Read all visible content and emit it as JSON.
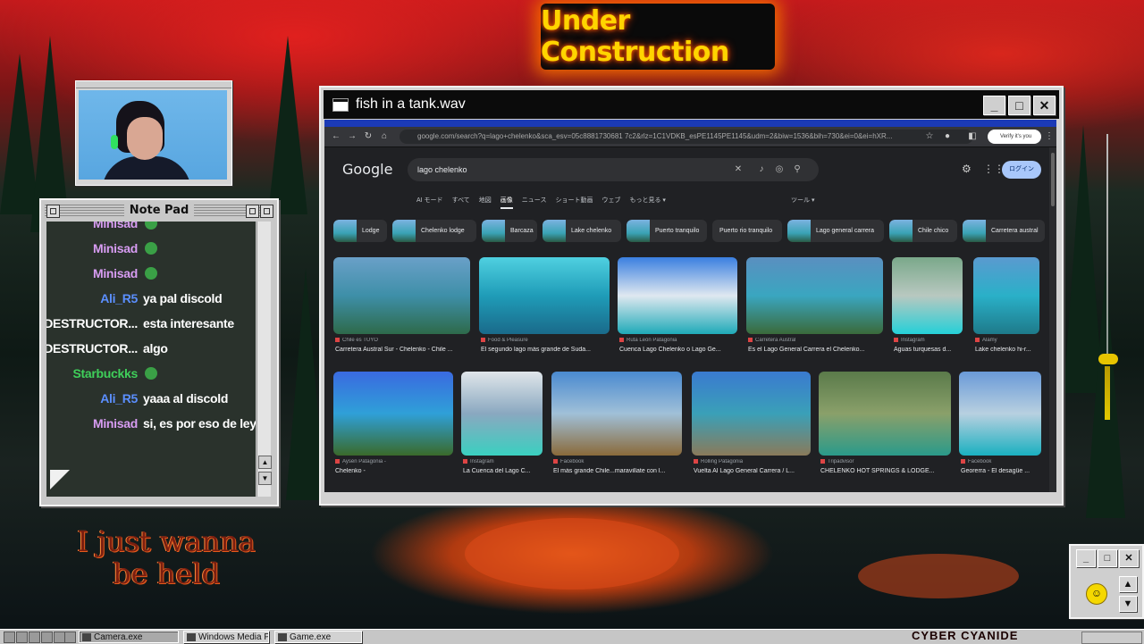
{
  "overlays": {
    "under_construction": "Under Construction",
    "held_line1": "I just wanna",
    "held_line2": "be held",
    "brand": "CYBER CYANIDE"
  },
  "notepad": {
    "title": "Note Pad",
    "messages": [
      {
        "user": "Minisad",
        "text": "",
        "user_color": "#d79cf2",
        "emote": true
      },
      {
        "user": "Minisad",
        "text": "",
        "user_color": "#d79cf2",
        "emote": true
      },
      {
        "user": "Minisad",
        "text": "",
        "user_color": "#d79cf2",
        "emote": true
      },
      {
        "user": "Ali_R5",
        "text": "ya pal discold",
        "user_color": "#5b8fff",
        "emote": false
      },
      {
        "user": "DESTRUCTOR...",
        "text": "esta interesante",
        "user_color": "#ffffff",
        "emote": false
      },
      {
        "user": "DESTRUCTOR...",
        "text": "algo",
        "user_color": "#ffffff",
        "emote": false
      },
      {
        "user": "Starbuckks",
        "text": "",
        "user_color": "#3fcf5a",
        "emote": true
      },
      {
        "user": "Ali_R5",
        "text": "yaaa al discold",
        "user_color": "#5b8fff",
        "emote": false
      },
      {
        "user": "Minisad",
        "text": "si, es por eso de ley XD",
        "user_color": "#d79cf2",
        "emote": false
      }
    ]
  },
  "browser_window": {
    "title": "fish in a tank.wav",
    "url": "google.com/search?q=lago+chelenko&sca_esv=05c8881730681 7c2&rlz=1C1VDKB_esPE1145PE1145&udm=2&biw=1536&bih=730&ei=0&ei=hXR...",
    "verify": "Verify it's you",
    "logo": "Google",
    "query": "lago chelenko",
    "login": "ログイン",
    "vertical_tabs": [
      "AI モード",
      "すべて",
      "地図",
      "画像",
      "ニュース",
      "ショート動画",
      "ウェブ",
      "もっと見る ▾"
    ],
    "selected_tab": "画像",
    "tools": "ツール ▾",
    "chips": [
      "Lodge",
      "Chelenko lodge",
      "Barcaza",
      "Lake chelenko",
      "Puerto tranquilo",
      "Puerto rio tranquilo",
      "Lago general carrera",
      "Chile chico",
      "Carretera austral"
    ],
    "row1": [
      {
        "source": "Chile es TUYO",
        "caption": "Carretera Austral Sur - Chelenko - Chile ...",
        "colors": [
          "#6aa0c8",
          "#3e8fa8",
          "#2e6a4a"
        ]
      },
      {
        "source": "Food & Pleasure",
        "caption": "El segundo lago más grande de Suda...",
        "colors": [
          "#4fd0e0",
          "#1f9cb8",
          "#1a6a8a"
        ]
      },
      {
        "source": "Ruta León Patagonia",
        "caption": "Cuenca Lago Chelenko o Lago Ge...",
        "colors": [
          "#3a7fe0",
          "#dfe8f0",
          "#1faab8"
        ]
      },
      {
        "source": "Carretera Austral",
        "caption": "Es el Lago General Carrera el Chelenko...",
        "colors": [
          "#5a8fc0",
          "#3aa6c0",
          "#3a6a3a"
        ]
      },
      {
        "source": "Instagram",
        "caption": "Aguas turquesas d...",
        "colors": [
          "#7aa88a",
          "#b8c8c0",
          "#25d0d8"
        ]
      },
      {
        "source": "Alamy",
        "caption": "Lake chelenko hi-r...",
        "colors": [
          "#5a9ad0",
          "#2ab0c8",
          "#1e7a8a"
        ]
      }
    ],
    "row2": [
      {
        "source": "Aysén Patagonia -",
        "caption": "Chelenko -",
        "colors": [
          "#3a6ae0",
          "#2fa0d8",
          "#3a6a2a"
        ]
      },
      {
        "source": "Instagram",
        "caption": "La Cuenca del Lago C...",
        "colors": [
          "#e0e6ea",
          "#8aa8c0",
          "#3ad0c0"
        ]
      },
      {
        "source": "Facebook",
        "caption": "El más grande Chile...maravillate con l...",
        "colors": [
          "#4a8ad0",
          "#a0c0d8",
          "#8a6a3a"
        ]
      },
      {
        "source": "Rolling Patagonia",
        "caption": "Vuelta Al Lago General Carrera / L...",
        "colors": [
          "#3a7ad0",
          "#3aa0b8",
          "#8a7a5a"
        ]
      },
      {
        "source": "Tripadvisor",
        "caption": "CHELENKO HOT SPRINGS & LODGE...",
        "colors": [
          "#5a7a4a",
          "#8aa06a",
          "#2a9a8a"
        ]
      },
      {
        "source": "Facebook",
        "caption": "Georerra - El desagüe ...",
        "colors": [
          "#6a9ad8",
          "#b8d0e0",
          "#1ab0c0"
        ]
      }
    ]
  },
  "taskbar": {
    "tasks": [
      "Camera.exe",
      "Windows Media Pla...",
      "Game.exe"
    ]
  },
  "colors": {
    "chrome_dark": "#202124",
    "window_frame": "#d2d2d2",
    "accent_blue": "#a8c7fa"
  }
}
